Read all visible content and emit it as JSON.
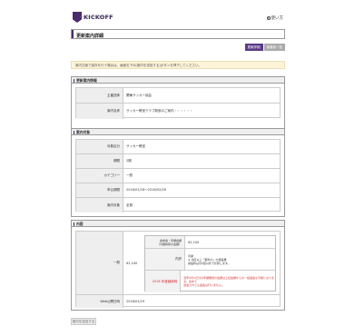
{
  "header": {
    "logo_text": "KICKOFF",
    "logo_sub": "Sports Management System",
    "help_label": "使い方",
    "help_icon": "?"
  },
  "page_title": "更新案内詳細",
  "tabs": [
    {
      "label": "更新詳細",
      "active": true
    },
    {
      "label": "保護者一覧",
      "active": false
    }
  ],
  "notice": "案内文面で保存を行う場合は、画面右下の[案内を送信する]ボタンを押下してください。",
  "sections": {
    "info": {
      "title": "更新案内情報",
      "rows": [
        {
          "k": "主催団体",
          "v": "関東サッカー協会"
        },
        {
          "k": "案内名称",
          "v": "サッカー教室クラブ新設のご案内・・・・・・"
        }
      ]
    },
    "target": {
      "title": "案内対象",
      "rows": [
        {
          "k": "対象区分",
          "v": "サッカー教室"
        },
        {
          "k": "期間",
          "v": "2期"
        },
        {
          "k": "カテゴリー",
          "v": "一般"
        },
        {
          "k": "申込期間",
          "v": "2016/01/16～2016/02/28"
        },
        {
          "k": "案内対象",
          "v": "全員"
        }
      ]
    },
    "content": {
      "title": "内容",
      "main_label": "一般",
      "main_amount": "¥2,100",
      "inner_rows": [
        {
          "k": "請求金・年額金額\n（月額換算の金額）",
          "v": "¥2,100"
        },
        {
          "k": "内訳",
          "v": "月謝\n※ 北区以上「都外の」の施設費\n施設料は月2回以外で計算します。"
        },
        {
          "k": "2016 年度継続時",
          "v": "翌年4月1日分の年額費用の会費は上記金額からの一括返金も可能になります。途中で\n退会されても返金は行いません。"
        }
      ],
      "date_row": {
        "k": "Web公開日時",
        "v": "2016/01/19"
      }
    }
  },
  "footer_button": "案内を送信する",
  "colors": {
    "brand": "#4b2a6e",
    "tab_active": "#5b3a86",
    "notice_bg": "#fdf3d8",
    "warn": "#d23030"
  }
}
